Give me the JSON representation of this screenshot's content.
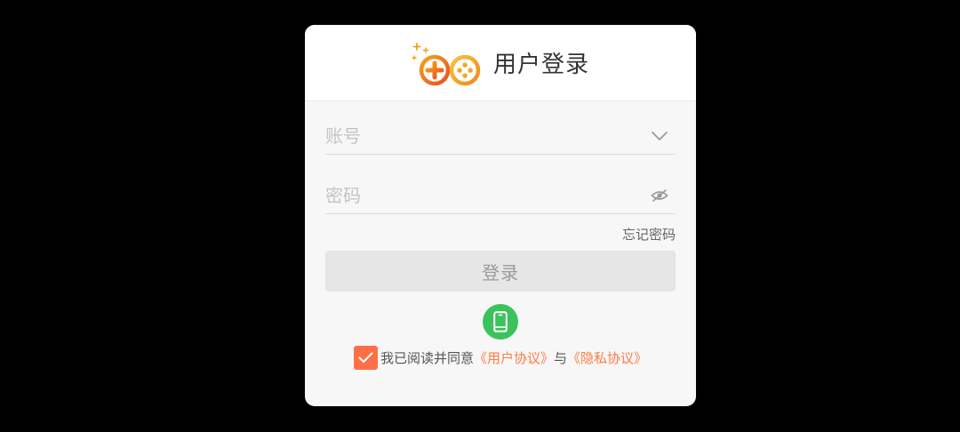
{
  "header": {
    "title": "用户登录",
    "logo_icon": "gamepad-logo-icon"
  },
  "account": {
    "placeholder": "账号",
    "value": "",
    "dropdown_icon": "chevron-down-icon"
  },
  "password": {
    "placeholder": "密码",
    "value": "",
    "toggle_icon": "eye-hidden-icon"
  },
  "forgot_label": "忘记密码",
  "login_label": "登录",
  "phone_login_icon": "phone-icon",
  "agreement": {
    "checked": true,
    "prefix": "我已阅读并同意",
    "user_agreement": "《用户协议》",
    "joiner": "与",
    "privacy_agreement": "《隐私协议》"
  },
  "colors": {
    "accent": "#ff7a45",
    "checkbox": "#ff6f45",
    "phone_button": "#3cc25c",
    "login_button": "#e6e6e6",
    "backdrop": "#000000"
  }
}
